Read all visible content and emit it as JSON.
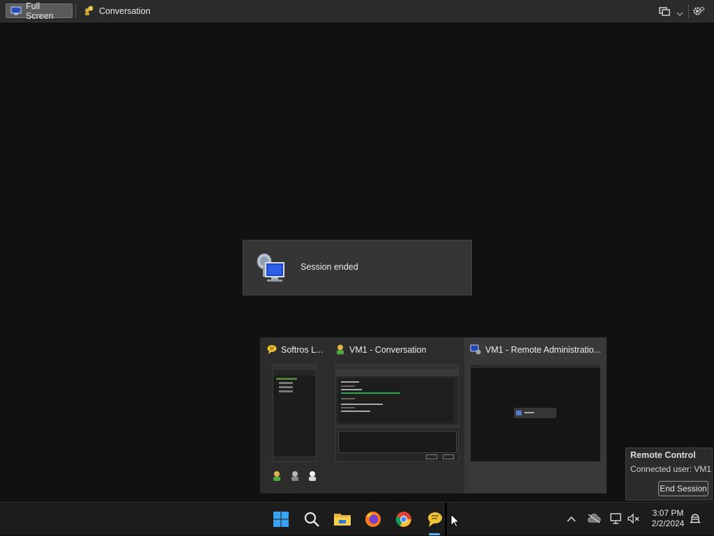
{
  "toolbar": {
    "full_screen_label": "Full Screen",
    "conversation_label": "Conversation"
  },
  "session_toast": {
    "message": "Session ended"
  },
  "task_view": {
    "windows": [
      {
        "title": "Softros L..."
      },
      {
        "title": "VM1 - Conversation"
      },
      {
        "title": "VM1 - Remote Administratio..."
      }
    ]
  },
  "remote_control": {
    "title": "Remote Control",
    "connected_user": "Connected user: VM1",
    "end_session_label": "End Session"
  },
  "taskbar": {
    "apps": [
      "start-icon",
      "search-icon",
      "file-explorer-icon",
      "firefox-icon",
      "chrome-icon",
      "softros-messenger-icon"
    ],
    "time": "3:07 PM",
    "date": "2/2/2024"
  },
  "colors": {
    "background": "#111111",
    "panel": "#2c2c2c",
    "toolbar": "#2b2b2b"
  }
}
